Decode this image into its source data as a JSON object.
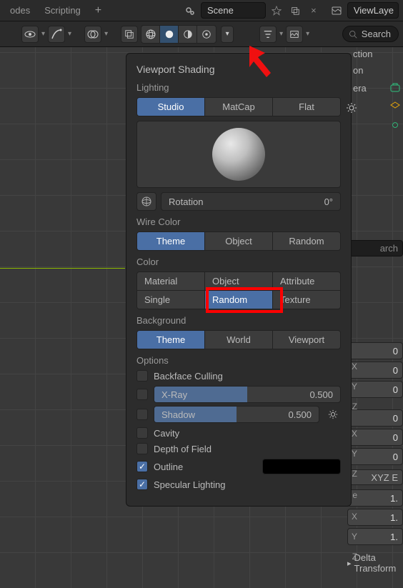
{
  "top": {
    "tabs": [
      "odes",
      "Scripting"
    ],
    "scene_label": "Scene",
    "viewlayer_label": "ViewLaye"
  },
  "toolbar": {
    "search_placeholder": "Search"
  },
  "panel": {
    "title": "Viewport Shading",
    "lighting_label": "Lighting",
    "lighting_opts": [
      "Studio",
      "MatCap",
      "Flat"
    ],
    "rotation_label": "Rotation",
    "rotation_value": "0°",
    "wirecolor_label": "Wire Color",
    "wirecolor_opts": [
      "Theme",
      "Object",
      "Random"
    ],
    "color_label": "Color",
    "color_opts_r1": [
      "Material",
      "Object",
      "Attribute"
    ],
    "color_opts_r2": [
      "Single",
      "Random",
      "Texture"
    ],
    "background_label": "Background",
    "background_opts": [
      "Theme",
      "World",
      "Viewport"
    ],
    "options_label": "Options",
    "backface_label": "Backface Culling",
    "xray_label": "X-Ray",
    "xray_value": "0.500",
    "shadow_label": "Shadow",
    "shadow_value": "0.500",
    "cavity_label": "Cavity",
    "dof_label": "Depth of Field",
    "outline_label": "Outline",
    "specular_label": "Specular Lighting"
  },
  "outliner": {
    "items": [
      "ction",
      "on",
      "era"
    ]
  },
  "props": {
    "search_label": "arch",
    "axes": [
      "X",
      "Y",
      "Z",
      "X",
      "Y",
      "Z"
    ],
    "zeros": "0",
    "mode_label": "e",
    "mode_value": "XYZ E",
    "ones": "1.",
    "delta_label": "Delta Transform"
  }
}
